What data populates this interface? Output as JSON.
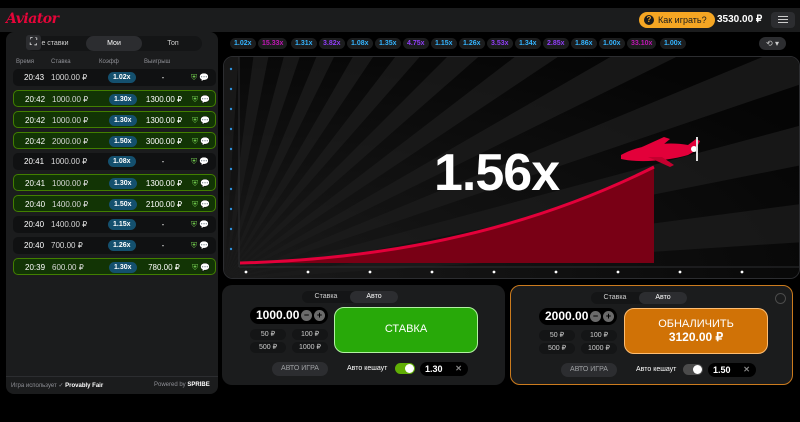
{
  "header": {
    "logo": "Aviator",
    "how_to_play": "Как играть?",
    "balance": "3530.00 ₽"
  },
  "left_panel": {
    "tabs": [
      "е ставки",
      "Мои",
      "Топ"
    ],
    "columns": [
      "Время",
      "Ставка",
      "Коэфф",
      "Выигрыш"
    ],
    "rows": [
      {
        "time": "20:43",
        "bet": "1000.00 ₽",
        "coef": "1.02x",
        "win": "-",
        "won": false
      },
      {
        "time": "20:42",
        "bet": "1000.00 ₽",
        "coef": "1.30x",
        "win": "1300.00 ₽",
        "won": true
      },
      {
        "time": "20:42",
        "bet": "1000.00 ₽",
        "coef": "1.30x",
        "win": "1300.00 ₽",
        "won": true
      },
      {
        "time": "20:42",
        "bet": "2000.00 ₽",
        "coef": "1.50x",
        "win": "3000.00 ₽",
        "won": true
      },
      {
        "time": "20:41",
        "bet": "1000.00 ₽",
        "coef": "1.08x",
        "win": "-",
        "won": false
      },
      {
        "time": "20:41",
        "bet": "1000.00 ₽",
        "coef": "1.30x",
        "win": "1300.00 ₽",
        "won": true
      },
      {
        "time": "20:40",
        "bet": "1400.00 ₽",
        "coef": "1.50x",
        "win": "2100.00 ₽",
        "won": true
      },
      {
        "time": "20:40",
        "bet": "1400.00 ₽",
        "coef": "1.15x",
        "win": "-",
        "won": false
      },
      {
        "time": "20:40",
        "bet": "700.00 ₽",
        "coef": "1.26x",
        "win": "-",
        "won": false
      },
      {
        "time": "20:39",
        "bet": "600.00 ₽",
        "coef": "1.30x",
        "win": "780.00 ₽",
        "won": true
      }
    ],
    "footer_text": "Игра использует",
    "footer_brand": "Provably Fair",
    "powered_text": "Powered by",
    "powered_brand": "SPRIBE"
  },
  "history": [
    {
      "v": "1.02x",
      "c": "#34b4ff"
    },
    {
      "v": "15.33x",
      "c": "#c017b4"
    },
    {
      "v": "1.31x",
      "c": "#34b4ff"
    },
    {
      "v": "3.82x",
      "c": "#913ef8"
    },
    {
      "v": "1.08x",
      "c": "#34b4ff"
    },
    {
      "v": "1.35x",
      "c": "#34b4ff"
    },
    {
      "v": "4.75x",
      "c": "#913ef8"
    },
    {
      "v": "1.15x",
      "c": "#34b4ff"
    },
    {
      "v": "1.26x",
      "c": "#34b4ff"
    },
    {
      "v": "3.53x",
      "c": "#913ef8"
    },
    {
      "v": "1.34x",
      "c": "#34b4ff"
    },
    {
      "v": "2.85x",
      "c": "#913ef8"
    },
    {
      "v": "1.86x",
      "c": "#34b4ff"
    },
    {
      "v": "1.00x",
      "c": "#34b4ff"
    },
    {
      "v": "33.10x",
      "c": "#c017b4"
    },
    {
      "v": "1.00x",
      "c": "#34b4ff"
    }
  ],
  "game": {
    "multiplier": "1.56x"
  },
  "bet_panels": [
    {
      "tabs": [
        "Ставка",
        "Авто"
      ],
      "amount": "1000.00",
      "quick": [
        "50 ₽",
        "100 ₽",
        "500 ₽",
        "1000 ₽"
      ],
      "button_line1": "СТАВКА",
      "button_line2": "",
      "auto_game": "АВТО ИГРА",
      "auto_cashout_label": "Авто кешаут",
      "auto_cashout_on": true,
      "auto_cashout_value": "1.30"
    },
    {
      "tabs": [
        "Ставка",
        "Авто"
      ],
      "amount": "2000.00",
      "quick": [
        "50 ₽",
        "100 ₽",
        "500 ₽",
        "1000 ₽"
      ],
      "button_line1": "ОБНАЛИЧИТЬ",
      "button_line2": "3120.00 ₽",
      "auto_game": "АВТО ИГРА",
      "auto_cashout_label": "Авто кешаут",
      "auto_cashout_on": false,
      "auto_cashout_value": "1.50"
    }
  ]
}
